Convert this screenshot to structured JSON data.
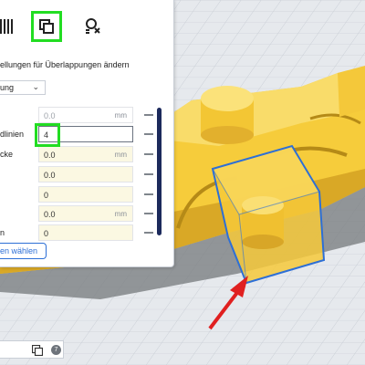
{
  "toolbar": {
    "tools": [
      {
        "name": "support-blocker",
        "icon": "support-blocker-icon"
      },
      {
        "name": "per-model-settings",
        "icon": "per-model-settings-icon",
        "active": true
      },
      {
        "name": "overhang-mesh",
        "icon": "overhang-mesh-icon"
      }
    ]
  },
  "panel": {
    "title": "ellungen für Überlappungen ändern",
    "mesh_type": "ung",
    "settings": [
      {
        "label": "",
        "value": "0.0",
        "unit": "mm",
        "disabled": true
      },
      {
        "label": "dlinien",
        "value": "4",
        "unit": "",
        "focused": true
      },
      {
        "label": "cke",
        "value": "0.0",
        "unit": "mm"
      },
      {
        "label": "",
        "value": "0.0",
        "unit": ""
      },
      {
        "label": "",
        "value": "0",
        "unit": ""
      },
      {
        "label": "",
        "value": "0.0",
        "unit": "mm"
      },
      {
        "label": "n",
        "value": "0",
        "unit": ""
      }
    ],
    "select_button": "en wählen"
  },
  "bottom": {
    "count": "7"
  },
  "colors": {
    "accent": "#2d6fd6",
    "highlight": "#22dd22",
    "model": "#f8d54a",
    "arrow": "#e02020"
  }
}
